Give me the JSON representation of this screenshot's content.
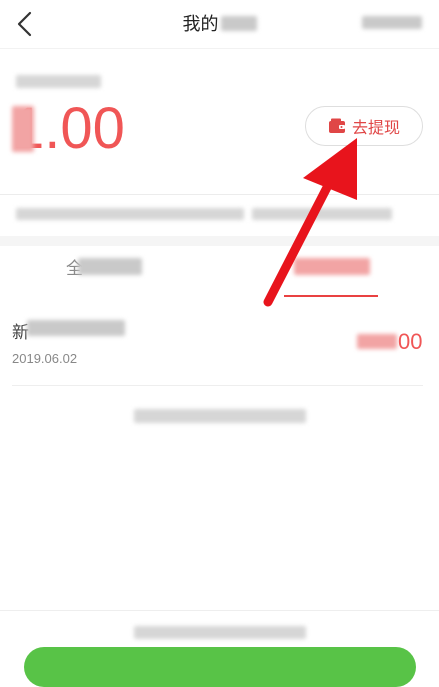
{
  "header": {
    "title": "我的"
  },
  "balance": {
    "amount": "1.00"
  },
  "withdraw_button": {
    "label": "去提现"
  },
  "tabs": [
    {
      "glyph": "全"
    },
    {
      "glyph": ""
    }
  ],
  "record": {
    "title_glyph": "新",
    "date": "2019.06.02",
    "amount": "00"
  },
  "colors": {
    "accent": "#f05656",
    "button_red": "#e04646",
    "green": "#58c347",
    "arrow": "#e8141c"
  },
  "icons": {
    "back": "back-chevron-icon",
    "withdraw": "wallet-icon",
    "overlay": "red-arrow-annotation"
  }
}
